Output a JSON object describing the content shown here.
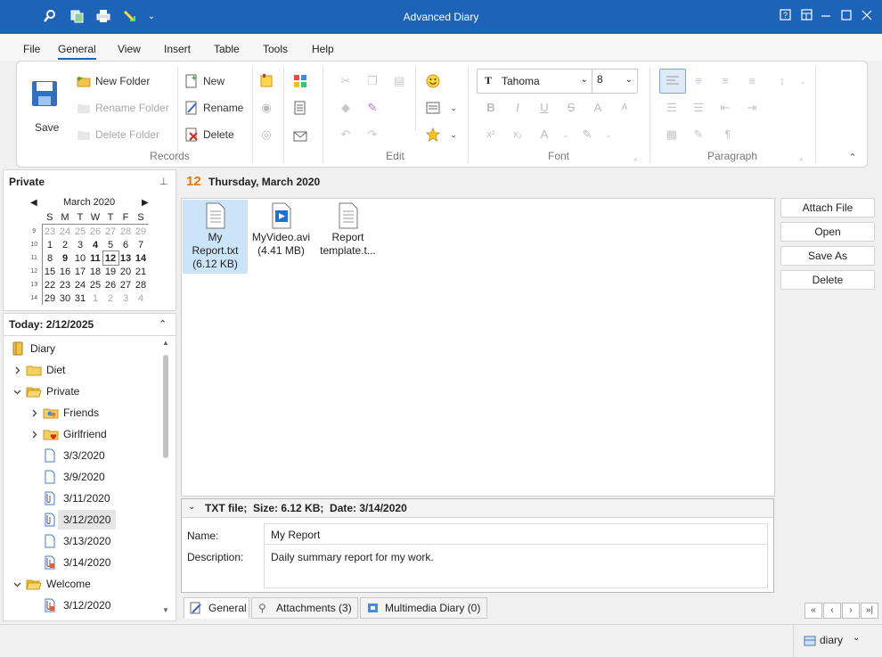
{
  "window": {
    "title": "Advanced Diary",
    "controls": {
      "help": "?",
      "restore_tabs": "▢",
      "minimize": "–",
      "maximize": "☐",
      "close": "✕"
    }
  },
  "quick_access": [
    "search-icon",
    "copy-icon",
    "print-icon",
    "sync-icon",
    "dropdown-icon"
  ],
  "menu": {
    "items": [
      "File",
      "General",
      "View",
      "Insert",
      "Table",
      "Tools",
      "Help"
    ],
    "active": "General"
  },
  "ribbon": {
    "records": {
      "caption": "Records",
      "save": "Save",
      "new_folder": "New Folder",
      "rename_folder": "Rename Folder",
      "delete_folder": "Delete Folder",
      "new": "New",
      "rename": "Rename",
      "delete": "Delete"
    },
    "edit": {
      "caption": "Edit"
    },
    "font": {
      "caption": "Font",
      "name": "Tahoma",
      "size": "8"
    },
    "paragraph": {
      "caption": "Paragraph"
    }
  },
  "left_panel": {
    "title": "Private",
    "calendar": {
      "month": "March 2020",
      "weekdays": [
        "S",
        "M",
        "T",
        "W",
        "T",
        "F",
        "S"
      ],
      "weeks": [
        {
          "wk": "9",
          "days": [
            "23",
            "24",
            "25",
            "26",
            "27",
            "28",
            "29"
          ]
        },
        {
          "wk": "10",
          "days": [
            "1",
            "2",
            "3",
            "4",
            "5",
            "6",
            "7"
          ]
        },
        {
          "wk": "11",
          "days": [
            "8",
            "9",
            "10",
            "11",
            "12",
            "13",
            "14"
          ]
        },
        {
          "wk": "12",
          "days": [
            "15",
            "16",
            "17",
            "18",
            "19",
            "20",
            "21"
          ]
        },
        {
          "wk": "13",
          "days": [
            "22",
            "23",
            "24",
            "25",
            "26",
            "27",
            "28"
          ]
        },
        {
          "wk": "14",
          "days": [
            "29",
            "30",
            "31",
            "1",
            "2",
            "3",
            "4"
          ]
        }
      ]
    },
    "today": "Today: 2/12/2025",
    "tree": [
      {
        "label": "Diary",
        "level": 0,
        "icon": "diary-icon",
        "expander": ""
      },
      {
        "label": "Diet",
        "level": 1,
        "icon": "folder-icon",
        "expander": ">"
      },
      {
        "label": "Private",
        "level": 1,
        "icon": "folder-open-icon",
        "expander": "v"
      },
      {
        "label": "Friends",
        "level": 2,
        "icon": "folder-people-icon",
        "expander": ">"
      },
      {
        "label": "Girlfriend",
        "level": 2,
        "icon": "folder-heart-icon",
        "expander": ">"
      },
      {
        "label": "3/3/2020",
        "level": 2,
        "icon": "page-icon",
        "expander": ""
      },
      {
        "label": "3/9/2020",
        "level": 2,
        "icon": "page-icon",
        "expander": ""
      },
      {
        "label": "3/11/2020",
        "level": 2,
        "icon": "page-clip-icon",
        "expander": ""
      },
      {
        "label": "3/12/2020",
        "level": 2,
        "icon": "page-clip-icon",
        "expander": "",
        "selected": true
      },
      {
        "label": "3/13/2020",
        "level": 2,
        "icon": "page-icon",
        "expander": ""
      },
      {
        "label": "3/14/2020",
        "level": 2,
        "icon": "page-media-icon",
        "expander": ""
      },
      {
        "label": "Welcome",
        "level": 1,
        "icon": "folder-open-icon",
        "expander": "v"
      },
      {
        "label": "3/12/2020",
        "level": 2,
        "icon": "page-media-icon",
        "expander": ""
      }
    ]
  },
  "main": {
    "day_number": "12",
    "date_title": "Thursday, March 2020",
    "files": [
      {
        "line1": "My",
        "line2": "Report.txt",
        "line3": "(6.12 KB)",
        "icon": "text-file-icon",
        "selected": true
      },
      {
        "line1": "MyVideo.avi",
        "line2": "(4.41 MB)",
        "line3": "",
        "icon": "video-file-icon",
        "selected": false
      },
      {
        "line1": "Report",
        "line2": "template.t...",
        "line3": "",
        "icon": "text-file-icon",
        "selected": false
      }
    ],
    "buttons": {
      "attach": "Attach File",
      "open": "Open",
      "save_as": "Save As",
      "delete": "Delete"
    },
    "details": {
      "header": "TXT file;  Size: 6.12 KB;  Date: 3/14/2020",
      "name_label": "Name:",
      "name_value": "My Report",
      "desc_label": "Description:",
      "desc_value": "Daily summary report for my work."
    },
    "tabs": [
      "General",
      "Attachments (3)",
      "Multimedia Diary (0)"
    ],
    "nav": [
      "«",
      "‹",
      "›",
      "»|"
    ]
  },
  "status": {
    "db": "diary"
  },
  "colors": {
    "titlebar": "#1d64b8",
    "selection": "#cce4f7",
    "accent_orange": "#e8760a"
  }
}
